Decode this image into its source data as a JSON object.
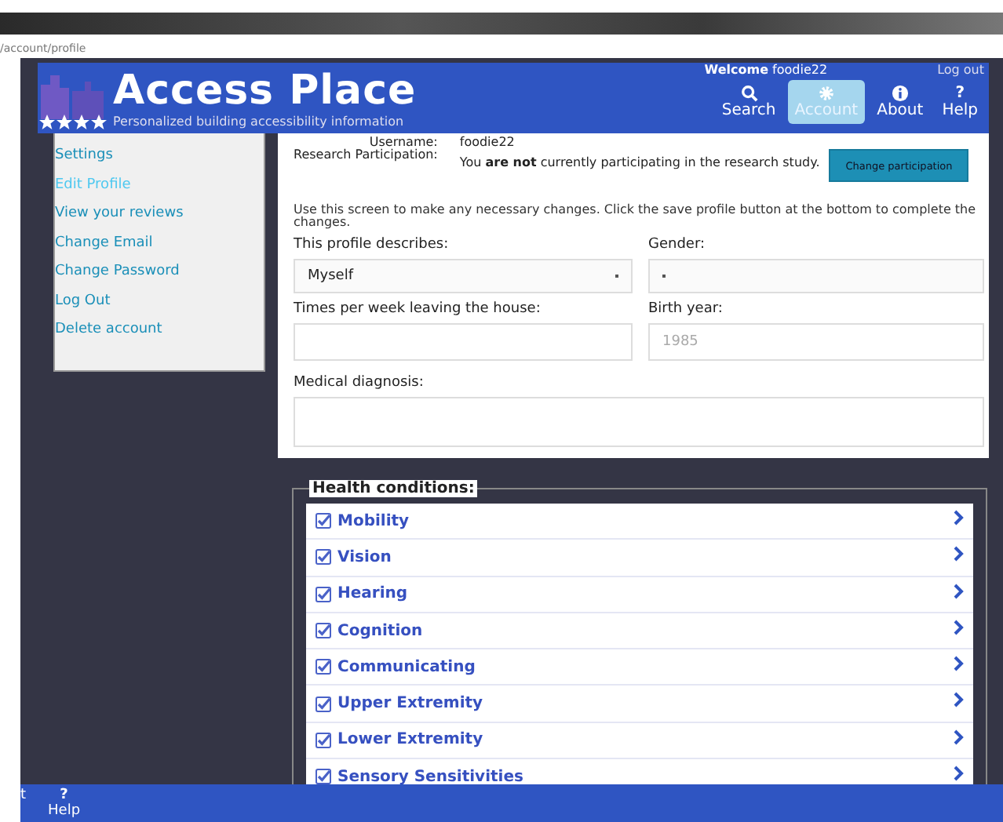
{
  "address_bar": {
    "url": "/account/profile"
  },
  "header": {
    "title": "Access Place",
    "subtitle": "Personalized building accessibility information",
    "welcome": "**Welcome** foodie22",
    "logout": "Log out",
    "nav": [
      {
        "label": "Search",
        "kind": "search",
        "selected": false
      },
      {
        "label": "Account",
        "kind": "settings",
        "selected": true
      },
      {
        "label": "About",
        "kind": "info",
        "selected": false
      },
      {
        "label": "Help",
        "glyph": "?",
        "selected": false
      }
    ]
  },
  "sidebar": {
    "items": [
      {
        "label": "Settings",
        "selected": false
      },
      {
        "label": "Edit Profile",
        "selected": true
      },
      {
        "label": "View your reviews",
        "selected": false
      },
      {
        "label": "Change Email",
        "selected": false
      },
      {
        "label": "Change Password",
        "selected": false
      },
      {
        "label": "Log Out",
        "selected": false
      },
      {
        "label": "Delete account",
        "selected": false
      }
    ]
  },
  "profile": {
    "username_label": "Username:",
    "username": "foodie22",
    "research_label": "Research Participation:",
    "research_text": "You **are not** currently participating in the research study.",
    "change_button": "Change participation",
    "instructions": "Use this screen to make any necessary changes. Click the save profile button at the bottom to complete the changes.",
    "fields": [
      {
        "label": "This profile describes:",
        "kind": "select",
        "value": "Myself"
      },
      {
        "label": "Gender:",
        "kind": "select"
      },
      {
        "label": "Times per week leaving the house:",
        "kind": "text"
      },
      {
        "label": "Birth year:",
        "kind": "text",
        "placeholder": "1985"
      },
      {
        "label": "Medical diagnosis:",
        "kind": "textarea"
      }
    ]
  },
  "health_conditions": {
    "legend": "Health conditions:",
    "items": [
      {
        "label": "Mobility",
        "checked": true
      },
      {
        "label": "Vision",
        "checked": true
      },
      {
        "label": "Hearing",
        "checked": true
      },
      {
        "label": "Cognition",
        "checked": true
      },
      {
        "label": "Communicating",
        "checked": true
      },
      {
        "label": "Upper Extremity",
        "checked": true
      },
      {
        "label": "Lower Extremity",
        "checked": true
      },
      {
        "label": "Sensory Sensitivities",
        "checked": true
      }
    ]
  },
  "bottom_bar": {
    "items": [
      {
        "label": "t"
      },
      {
        "glyph": "?",
        "label": "Help"
      }
    ]
  }
}
